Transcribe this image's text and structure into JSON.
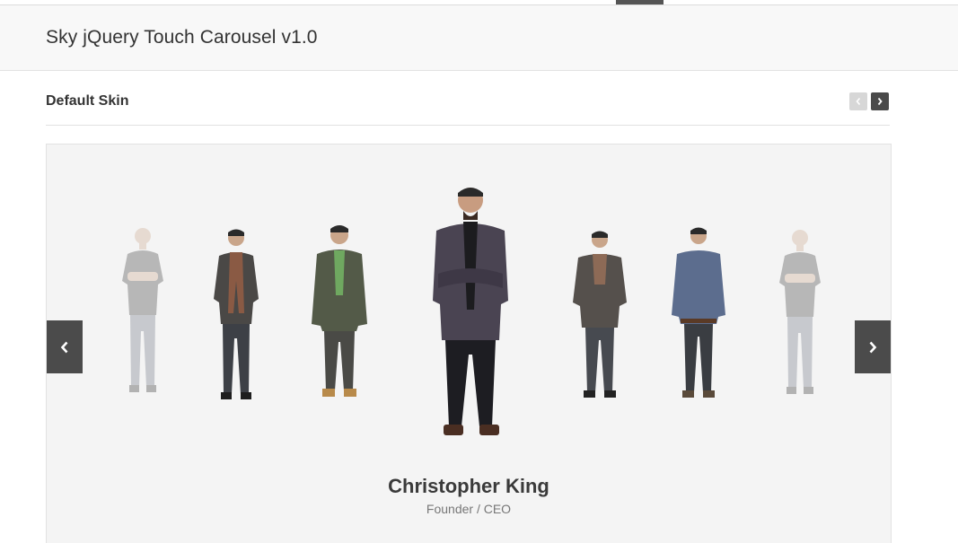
{
  "header": {
    "title": "Sky jQuery Touch Carousel v1.0"
  },
  "section": {
    "label": "Default Skin"
  },
  "carousel": {
    "featured": {
      "name": "Christopher King",
      "role": "Founder / CEO"
    },
    "items": [
      {
        "outfit": "dark t-shirt, jeans",
        "faded": true
      },
      {
        "outfit": "gray jacket, scarf",
        "faded": false
      },
      {
        "outfit": "olive jacket, green shirt",
        "faded": false
      },
      {
        "outfit": "dark suit, black shirt",
        "faded": false,
        "featured": true
      },
      {
        "outfit": "gray blazer, scarf",
        "faded": false
      },
      {
        "outfit": "striped blue shirt",
        "faded": false
      },
      {
        "outfit": "dark t-shirt, jeans",
        "faded": true
      }
    ]
  },
  "colors": {
    "accent_dark": "#4b4b4b",
    "background": "#f4f4f4",
    "header_bg": "#f8f8f8"
  },
  "icons": [
    "chevron-left-icon",
    "chevron-right-icon"
  ]
}
